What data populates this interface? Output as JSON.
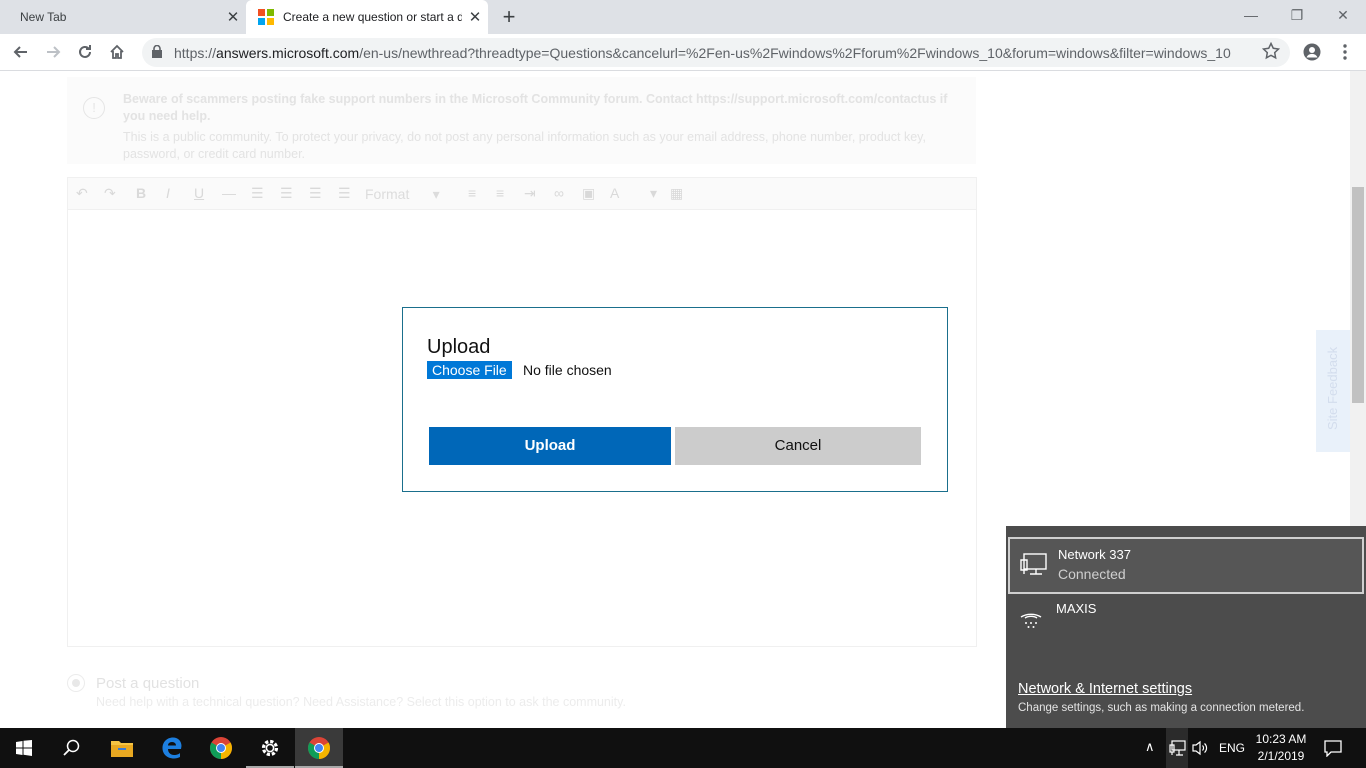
{
  "browser": {
    "tabs": [
      {
        "title": "New Tab",
        "active": false
      },
      {
        "title": "Create a new question or start a d",
        "active": true
      }
    ],
    "new_tab_label": "+",
    "url": {
      "scheme": "https://",
      "host": "answers.microsoft.com",
      "path": "/en-us/newthread?threadtype=Questions&cancelurl=%2Fen-us%2Fwindows%2Fforum%2Fwindows_10&forum=windows&filter=windows_10"
    },
    "window_controls": [
      "minimize",
      "restore",
      "close"
    ]
  },
  "page": {
    "notice": {
      "bold": "Beware of scammers posting fake support numbers in the Microsoft Community forum. Contact https://support.microsoft.com/contactus if you need help.",
      "text": "This is a public community. To protect your privacy, do not post any personal information such as your email address, phone number, product key, password, or credit card number."
    },
    "editor": {
      "format_label": "Format"
    },
    "post_option": {
      "title": "Post a question",
      "subtitle": "Need help with a technical question? Need Assistance? Select this option to ask the community."
    },
    "site_feedback": "Site Feedback"
  },
  "upload_dialog": {
    "title": "Upload",
    "choose_file_label": "Choose File",
    "file_status": "No file chosen",
    "upload_label": "Upload",
    "cancel_label": "Cancel"
  },
  "network_flyout": {
    "networks": [
      {
        "name": "Network 337",
        "status": "Connected",
        "icon": "ethernet-icon"
      },
      {
        "name": "MAXIS",
        "status": "",
        "icon": "dialup-icon"
      }
    ],
    "settings_link": "Network & Internet settings",
    "settings_desc": "Change settings, such as making a connection metered."
  },
  "taskbar": {
    "pinned": [
      "start-icon",
      "search-icon",
      "file-explorer-icon",
      "edge-icon",
      "chrome-icon",
      "settings-icon",
      "chrome-icon"
    ],
    "language": "ENG",
    "time": "10:23 AM",
    "date": "2/1/2019"
  },
  "colors": {
    "accent": "#0067b8",
    "choose_file": "#0078d7",
    "flyout_bg": "#4c4c4c",
    "taskbar_bg": "#101010",
    "ms_logo": [
      "#f25022",
      "#7fba00",
      "#00a4ef",
      "#ffb900"
    ]
  }
}
